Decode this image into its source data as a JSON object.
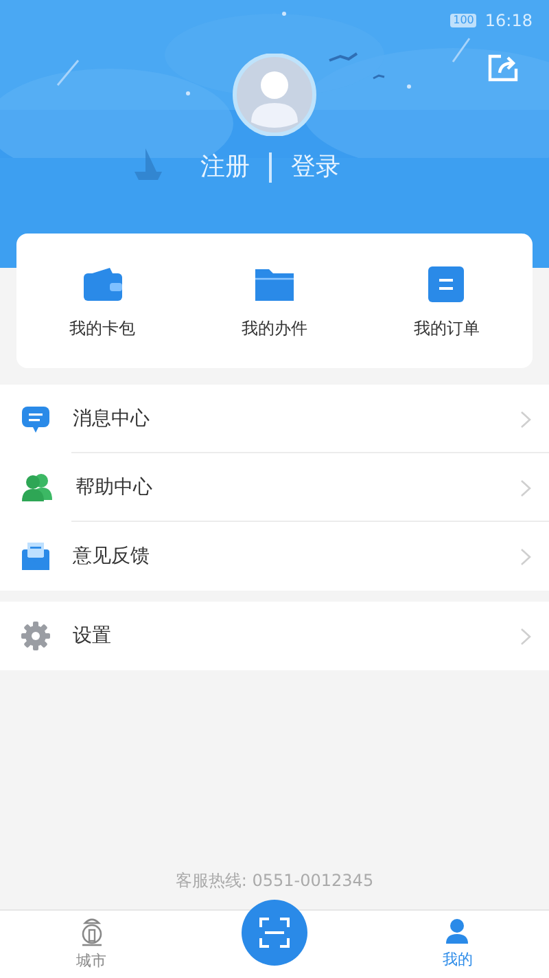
{
  "status_bar": {
    "battery": "100",
    "time": "16:18"
  },
  "header": {
    "register": "注册",
    "login": "登录"
  },
  "shortcuts": [
    {
      "label": "我的卡包",
      "kind": "wallet"
    },
    {
      "label": "我的办件",
      "kind": "folder"
    },
    {
      "label": "我的订单",
      "kind": "order"
    }
  ],
  "menu": [
    {
      "label": "消息中心",
      "kind": "message"
    },
    {
      "label": "帮助中心",
      "kind": "help"
    },
    {
      "label": "意见反馈",
      "kind": "feedback"
    }
  ],
  "settings": [
    {
      "label": "设置",
      "kind": "settings"
    }
  ],
  "hotline": "客服热线: 0551-0012345",
  "nav": [
    {
      "label": "城市",
      "kind": "city",
      "selected": false
    },
    {
      "kind": "scan",
      "selected": false
    },
    {
      "label": "我的",
      "kind": "me",
      "selected": true
    }
  ]
}
